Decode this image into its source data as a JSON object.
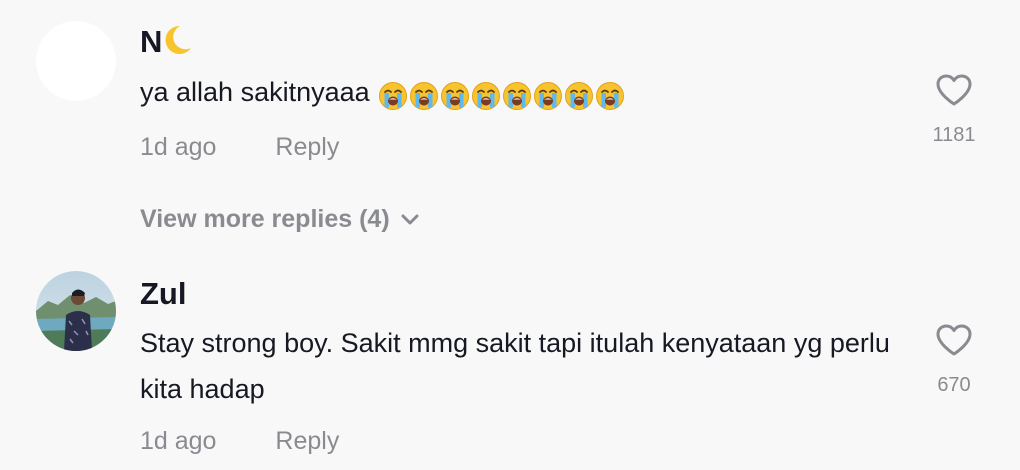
{
  "comments": [
    {
      "username": "N",
      "username_emoji": "crescent-moon",
      "text": "ya allah sakitnyaaa",
      "emoji": "loudly-crying-face",
      "emoji_count": 8,
      "time": "1d ago",
      "reply_label": "Reply",
      "likes": "1181",
      "avatar": "blank-white-avatar"
    },
    {
      "username": "Zul",
      "text": "Stay strong boy. Sakit mmg sakit tapi itulah kenyataan yg perlu kita hadap",
      "time": "1d ago",
      "reply_label": "Reply",
      "likes": "670",
      "avatar": "photo-avatar-man-lake-mountains"
    }
  ],
  "view_more_replies": "View more replies (4)",
  "colors": {
    "background": "#f8f8f8",
    "text_primary": "#161823",
    "text_secondary": "#8a8b91",
    "heart_stroke": "#8a8b91"
  }
}
